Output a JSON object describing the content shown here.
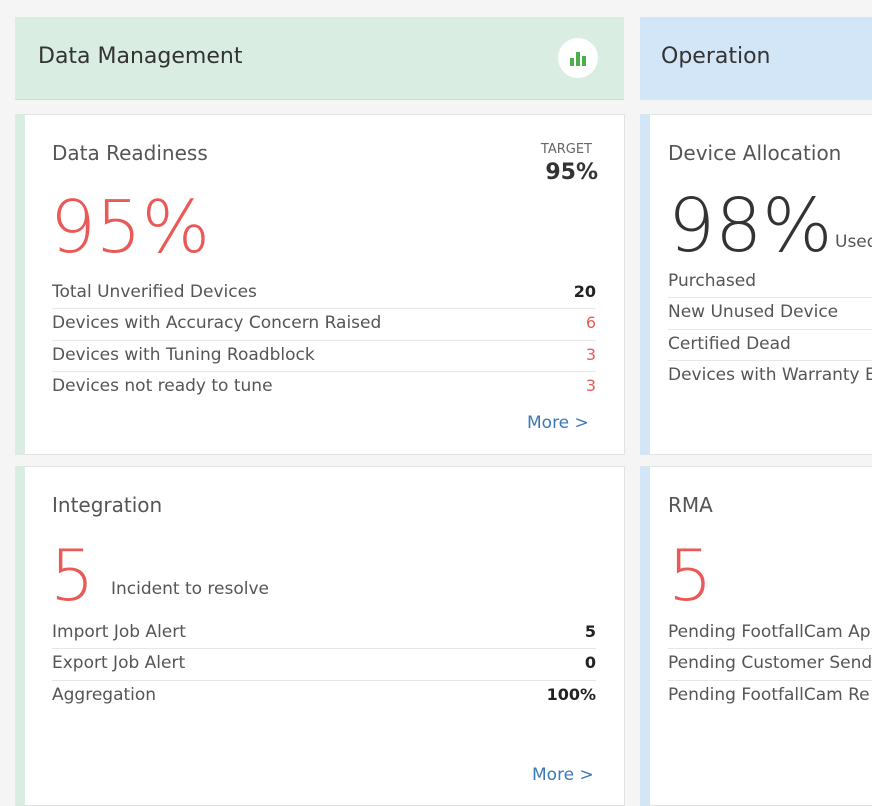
{
  "data_management": {
    "title": "Data Management",
    "chart_icon": "bar-chart-icon"
  },
  "operation": {
    "title": "Operation"
  },
  "data_readiness": {
    "title": "Data Readiness",
    "target_label": "TARGET",
    "target_value": "95%",
    "big_value": "95%",
    "rows": [
      {
        "label": "Total Unverified Devices",
        "value": "20"
      },
      {
        "label": "Devices with Accuracy Concern Raised",
        "value": "6"
      },
      {
        "label": "Devices with Tuning Roadblock",
        "value": "3"
      },
      {
        "label": "Devices not ready to tune",
        "value": "3"
      }
    ],
    "more": "More >"
  },
  "integration": {
    "title": "Integration",
    "big_value": "5",
    "caption": "Incident to resolve",
    "rows": [
      {
        "label": "Import Job Alert",
        "value": "5"
      },
      {
        "label": "Export Job Alert",
        "value": "0"
      },
      {
        "label": "Aggregation",
        "value": "100%"
      }
    ],
    "more": "More >"
  },
  "device_allocation": {
    "title": "Device Allocation",
    "big_value": "98%",
    "caption": "Used",
    "rows": [
      {
        "label": "Purchased"
      },
      {
        "label": "New Unused Device"
      },
      {
        "label": "Certified Dead"
      },
      {
        "label": "Devices with Warranty E"
      }
    ]
  },
  "rma": {
    "title": "RMA",
    "big_value": "5",
    "rows": [
      {
        "label": "Pending FootfallCam Ap"
      },
      {
        "label": "Pending Customer Send"
      },
      {
        "label": "Pending FootfallCam Re"
      }
    ]
  },
  "colors": {
    "red": "#e95a57",
    "link": "#3b78b8",
    "green_header": "#d9ede3",
    "blue_header": "#d3e6f7"
  }
}
